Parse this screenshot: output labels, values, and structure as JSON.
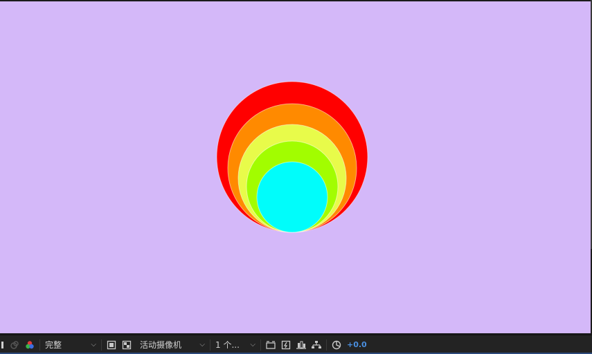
{
  "composition": {
    "background_color": "#d4b8f9",
    "circles": [
      {
        "name": "red",
        "color": "#ff0000"
      },
      {
        "name": "orange",
        "color": "#ff8a00"
      },
      {
        "name": "yellow",
        "color": "#e8fb4a"
      },
      {
        "name": "green",
        "color": "#a2fd00"
      },
      {
        "name": "cyan",
        "color": "#00fdfb"
      }
    ]
  },
  "toolbar": {
    "resolution_value": "完整",
    "camera_value": "活动摄像机",
    "views_value": "1 个...",
    "exposure_value": "+0.0",
    "icons": [
      "camera-icon",
      "color-channels-icon",
      "region-of-interest-icon",
      "transparency-grid-icon",
      "3d-view-icon",
      "fast-preview-icon",
      "timeline-icon",
      "flowchart-icon",
      "reset-exposure-icon"
    ],
    "accent_color": "#4a8fe0"
  }
}
